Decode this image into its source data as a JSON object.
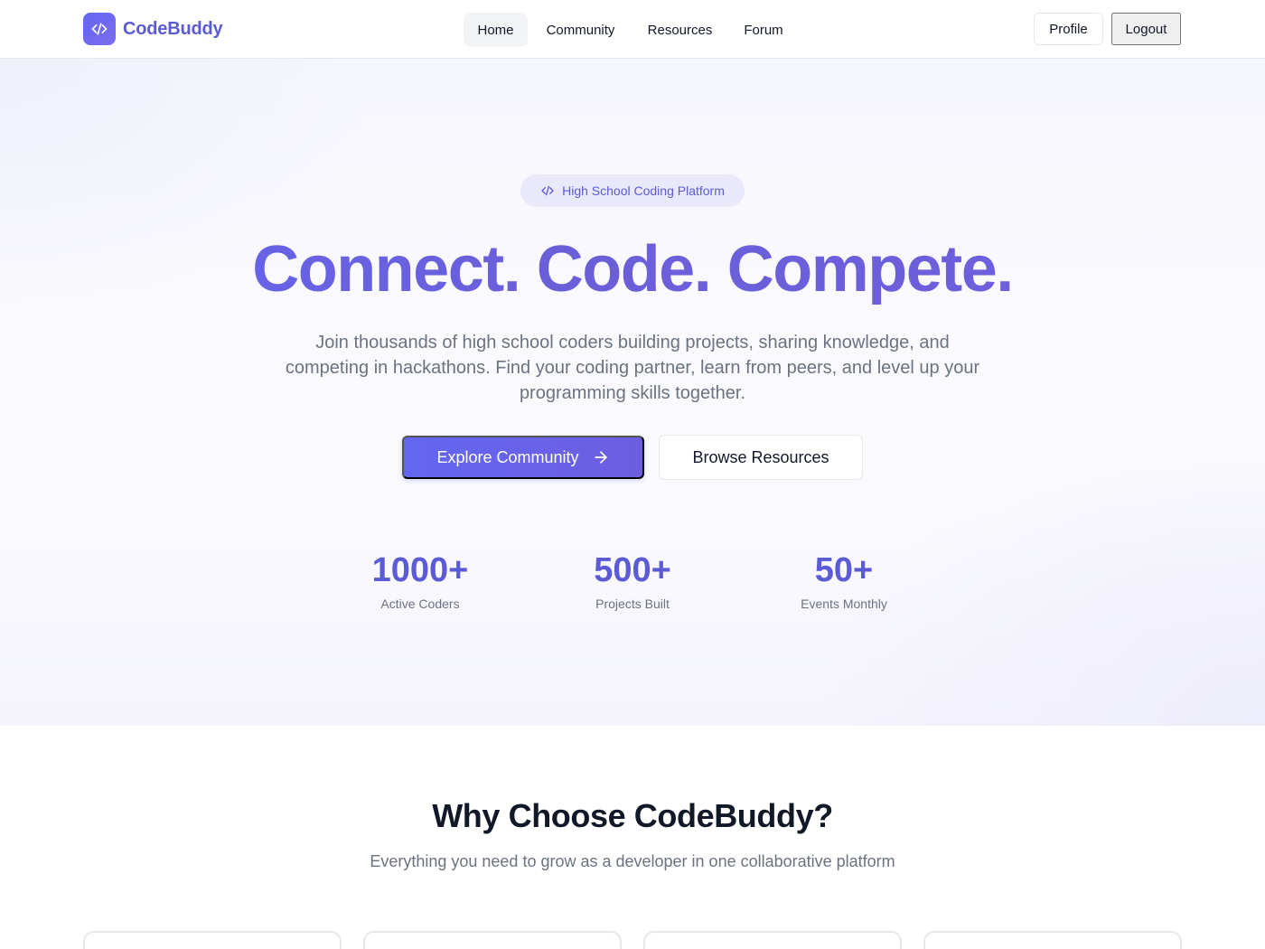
{
  "brand": {
    "name": "CodeBuddy",
    "logo_icon": "code-icon",
    "accent": "#6366f1"
  },
  "nav": {
    "items": [
      {
        "label": "Home",
        "active": true
      },
      {
        "label": "Community",
        "active": false
      },
      {
        "label": "Resources",
        "active": false
      },
      {
        "label": "Forum",
        "active": false
      }
    ],
    "profile_label": "Profile",
    "logout_label": "Logout"
  },
  "hero": {
    "pill_icon": "code-icon",
    "pill_label": "High School Coding Platform",
    "headline": "Connect. Code. Compete.",
    "subtext": "Join thousands of high school coders building projects, sharing knowledge, and competing in hackathons. Find your coding partner, learn from peers, and level up your programming skills together.",
    "primary_cta": {
      "label": "Explore Community",
      "icon": "arrow-right-icon"
    },
    "secondary_cta": {
      "label": "Browse Resources"
    },
    "stats": [
      {
        "value": "1000+",
        "label": "Active Coders"
      },
      {
        "value": "500+",
        "label": "Projects Built"
      },
      {
        "value": "50+",
        "label": "Events Monthly"
      }
    ]
  },
  "features": {
    "title": "Why Choose CodeBuddy?",
    "subtitle": "Everything you need to grow as a developer in one collaborative platform"
  }
}
